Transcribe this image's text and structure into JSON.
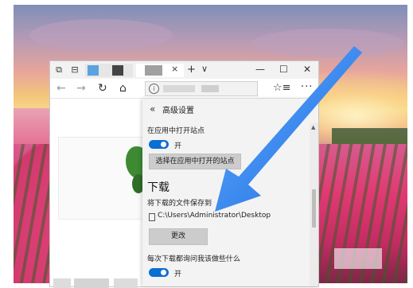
{
  "colors": {
    "accent": "#0a6fd1",
    "arrow": "#2f7fe6"
  },
  "tabbar": {
    "icons": [
      "tab-preview-icon",
      "tab-aside-icon"
    ],
    "close_glyph": "×",
    "newtab_glyph": "+",
    "tabmenu_glyph": "∨",
    "minimize_glyph": "—",
    "maximize_glyph": "☐",
    "close_window_glyph": "✕"
  },
  "toolbar": {
    "back_glyph": "←",
    "forward_glyph": "→",
    "refresh_glyph": "↻",
    "home_glyph": "⌂",
    "info_glyph": "i",
    "favorites_glyph": "☆≡",
    "more_glyph": "···"
  },
  "panel": {
    "back_glyph": "«",
    "title": "高级设置",
    "pin_glyph": "⊣",
    "open_in_apps_label": "在应用中打开站点",
    "toggle1_label": "开",
    "choose_apps_button": "选择在应用中打开的站点",
    "downloads_heading": "下载",
    "save_to_label": "将下载的文件保存到",
    "download_path": "C:\\Users\\Administrator\\Desktop",
    "change_button": "更改",
    "ask_label": "每次下载都询问我该做些什么",
    "toggle2_label": "开"
  }
}
